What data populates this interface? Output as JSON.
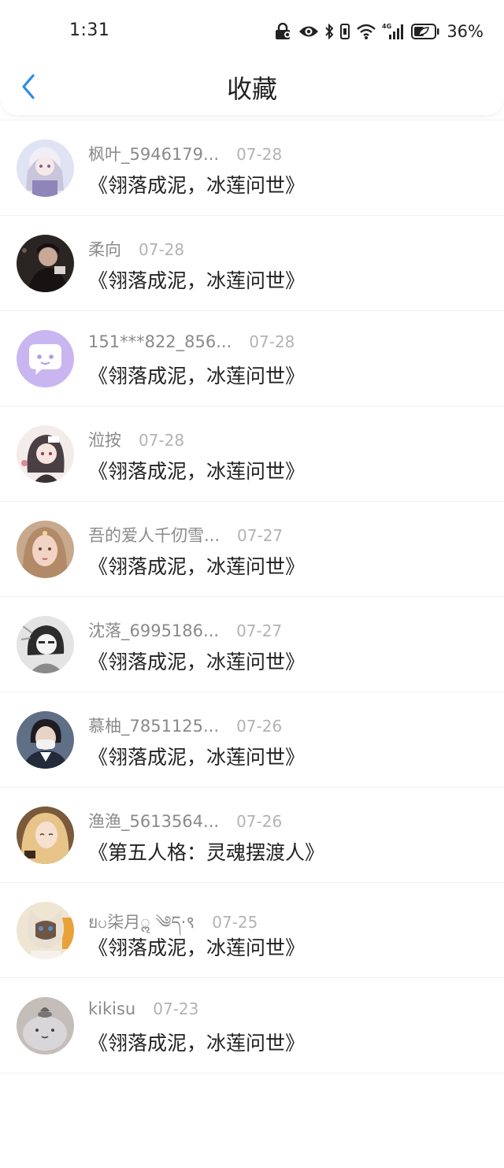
{
  "status_bar": {
    "time": "1:31",
    "battery_percent": "36%",
    "network": "4G",
    "icons": [
      "lock-icon",
      "eye-icon",
      "bluetooth-icon",
      "vibrate-icon",
      "wifi-icon",
      "signal-icon",
      "battery-saver-icon"
    ]
  },
  "header": {
    "back_icon": "chevron-left-icon",
    "title": "收藏",
    "accent_color": "#2b8de6"
  },
  "favorites": [
    {
      "username": "枫叶_5946179...",
      "date": "07-28",
      "book": "《翎落成泥，冰莲问世》",
      "avatar": "anime-girl-silver-hair"
    },
    {
      "username": "柔向",
      "date": "07-28",
      "book": "《翎落成泥，冰莲问世》",
      "avatar": "dark-portrait"
    },
    {
      "username": "151***822_856...",
      "date": "07-28",
      "book": "《翎落成泥，冰莲问世》",
      "avatar": "default-chat-bubble"
    },
    {
      "username": "涖按",
      "date": "07-28",
      "book": "《翎落成泥，冰莲问世》",
      "avatar": "anime-girl-dark-hair"
    },
    {
      "username": "吾的爱人千仞雪...",
      "date": "07-27",
      "book": "《翎落成泥，冰莲问世》",
      "avatar": "anime-girl-blonde"
    },
    {
      "username": "沈落_6995186...",
      "date": "07-27",
      "book": "《翎落成泥，冰莲问世》",
      "avatar": "manga-grayscale"
    },
    {
      "username": "慕柚_7851125...",
      "date": "07-26",
      "book": "《翎落成泥，冰莲问世》",
      "avatar": "masked-student"
    },
    {
      "username": "渔渔_5613564...",
      "date": "07-26",
      "book": "《第五人格：灵魂摆渡人》",
      "avatar": "anime-girl-golden"
    },
    {
      "username": "ยပ柒月ॢ ༄ད·९",
      "date": "07-25",
      "book": "《翎落成泥，冰莲问世》",
      "avatar": "ragdoll-cat"
    },
    {
      "username": "kikisu",
      "date": "07-23",
      "book": "《翎落成泥，冰莲问世》",
      "avatar": "gray-plush"
    }
  ]
}
